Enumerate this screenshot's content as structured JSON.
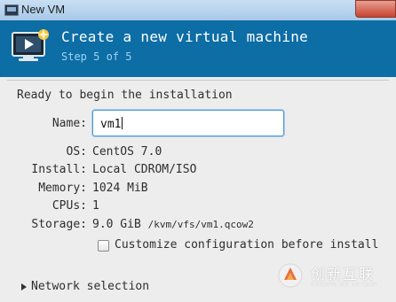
{
  "window": {
    "title": "New VM"
  },
  "header": {
    "title": "Create a new virtual machine",
    "step": "Step 5 of 5"
  },
  "main": {
    "heading": "Ready to begin the installation",
    "name": {
      "label": "Name:",
      "value": "vm1"
    },
    "details": [
      {
        "label": "OS:",
        "value": "CentOS 7.0"
      },
      {
        "label": "Install:",
        "value": "Local CDROM/ISO"
      },
      {
        "label": "Memory:",
        "value": "1024 MiB"
      },
      {
        "label": "CPUs:",
        "value": "1"
      },
      {
        "label": "Storage:",
        "value": "9.0 GiB",
        "path": "/kvm/vfs/vm1.qcow2"
      }
    ],
    "customize": {
      "label": "Customize configuration before install",
      "checked": false
    },
    "network": {
      "label": "Network selection",
      "expanded": false
    }
  },
  "watermark": {
    "brand": "创新互联",
    "sub": "CHUANG XIN HU LIAN"
  },
  "colors": {
    "header_bg": "#0d6da5",
    "step_text": "#9ed4f4",
    "focus_border": "#4f9ad6",
    "titlebar": "#a8c9e8"
  }
}
